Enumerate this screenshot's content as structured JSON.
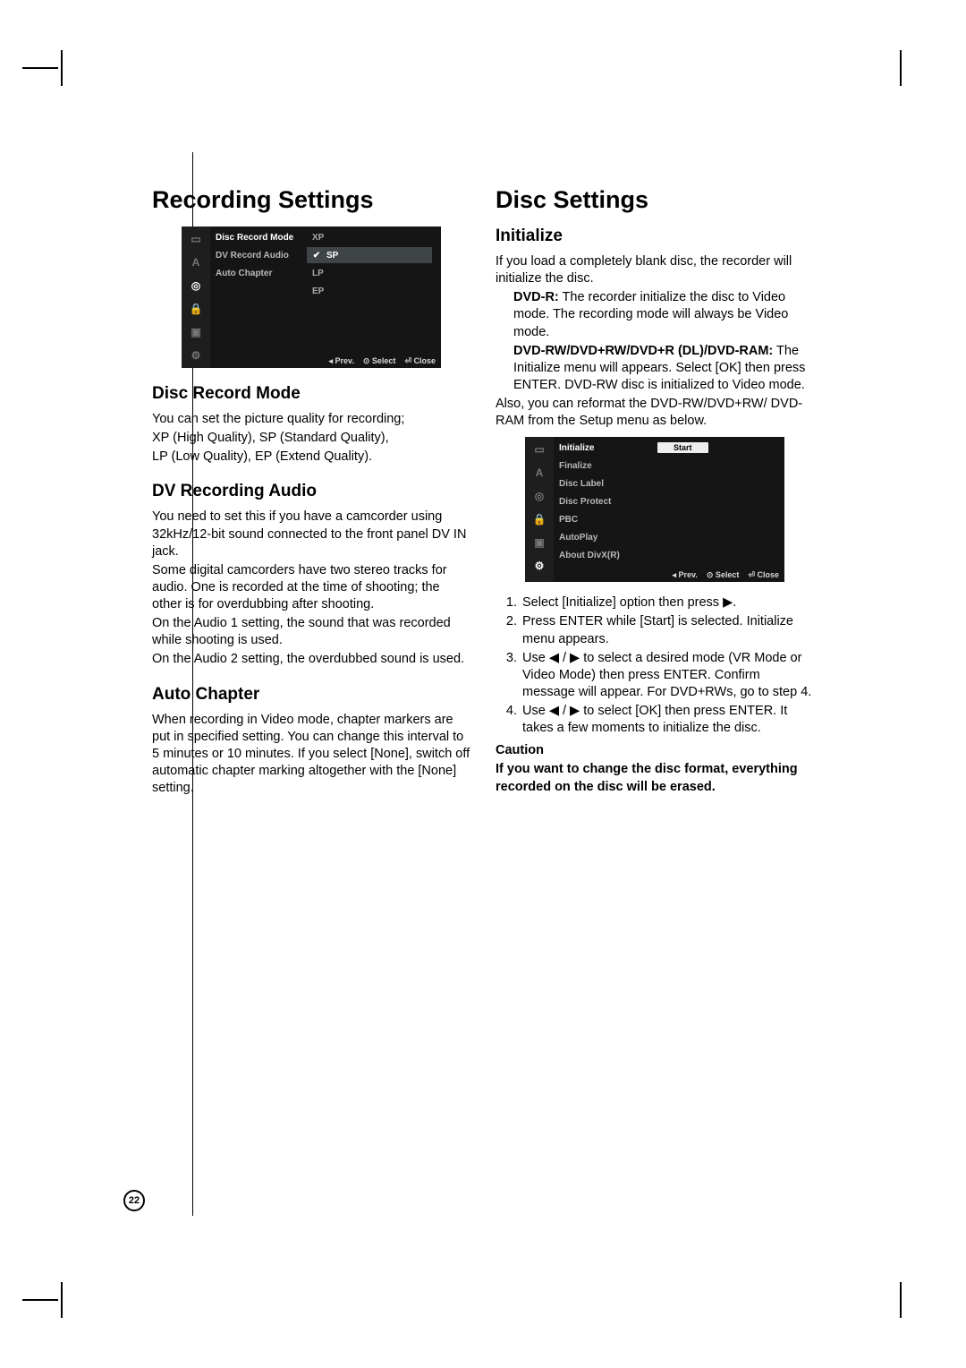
{
  "page_number": "22",
  "left": {
    "h1": "Recording Settings",
    "osd1": {
      "rows": [
        {
          "label": "Disc Record Mode",
          "value": "XP"
        },
        {
          "label": "DV Record Audio",
          "value": "SP",
          "selected": true
        },
        {
          "label": "Auto Chapter",
          "value": "LP"
        },
        {
          "label": "",
          "value": "EP"
        }
      ],
      "footer": {
        "prev": "Prev.",
        "select": "Select",
        "close": "Close"
      }
    },
    "sec1_h2": "Disc Record Mode",
    "sec1_p1": "You can set the picture quality for recording;",
    "sec1_p2": "XP (High Quality), SP (Standard Quality),",
    "sec1_p3": "LP (Low Quality), EP (Extend Quality).",
    "sec2_h2": "DV Recording Audio",
    "sec2_p1": "You need to set this if you have a camcorder using 32kHz/12-bit sound connected to the front panel DV IN jack.",
    "sec2_p2": "Some digital camcorders have two stereo tracks for audio. One is recorded at the time of shooting; the other is for overdubbing after shooting.",
    "sec2_p3": "On the Audio 1 setting, the sound that was recorded while shooting is used.",
    "sec2_p4": "On the Audio 2 setting, the overdubbed sound is used.",
    "sec3_h2": "Auto Chapter",
    "sec3_p1": "When recording in Video mode, chapter markers are put in specified setting. You can change this interval to 5 minutes or 10 minutes. If you select [None], switch off automatic chapter marking altogether with the [None] setting."
  },
  "right": {
    "h1": "Disc Settings",
    "sec1_h2": "Initialize",
    "sec1_p1": "If you load a completely blank disc, the recorder will initialize the disc.",
    "sec1_bullet1_strong": "DVD-R:",
    "sec1_bullet1_rest": " The recorder initialize the disc to Video mode. The recording mode will always be Video mode.",
    "sec1_bullet2_strong": "DVD-RW/DVD+RW/DVD+R (DL)/DVD-RAM:",
    "sec1_bullet2_rest": " The Initialize menu will appears. Select [OK] then press ENTER. DVD-RW disc is initialized to Video mode.",
    "sec1_p2": "Also, you can reformat the DVD-RW/DVD+RW/ DVD-RAM from the Setup menu as below.",
    "osd2": {
      "rows": [
        {
          "label": "Initialize",
          "value_button": "Start",
          "active": true
        },
        {
          "label": "Finalize"
        },
        {
          "label": "Disc Label"
        },
        {
          "label": "Disc Protect"
        },
        {
          "label": "PBC"
        },
        {
          "label": "AutoPlay"
        },
        {
          "label": "About DivX(R)"
        }
      ],
      "footer": {
        "prev": "Prev.",
        "select": "Select",
        "close": "Close"
      }
    },
    "steps": {
      "s1": "Select [Initialize] option then press ▶.",
      "s2": "Press ENTER while [Start] is selected. Initialize menu appears.",
      "s3": "Use ◀ / ▶ to select a desired mode (VR Mode or Video Mode) then press ENTER. Confirm message will appear. For DVD+RWs, go to step 4.",
      "s4": "Use ◀ / ▶ to select [OK] then press ENTER. It takes a few moments to initialize the disc."
    },
    "caution_label": "Caution",
    "caution_text": "If you want to change the disc format, everything recorded on the disc will be erased."
  }
}
